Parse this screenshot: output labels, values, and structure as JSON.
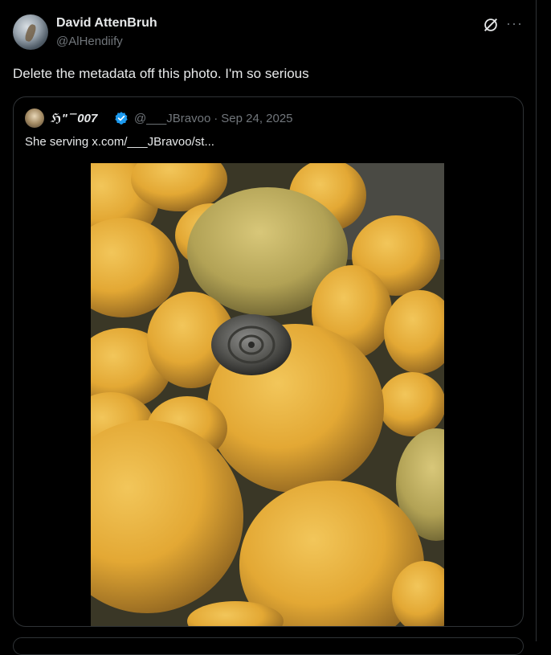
{
  "post": {
    "author": {
      "display_name": "David AttenBruh",
      "handle": "@AlHendiify"
    },
    "text": "Delete the metadata off this photo. I'm so serious",
    "icons": {
      "grok": "grok-icon",
      "more": "more-horizontal-icon"
    }
  },
  "quoted_post": {
    "display_name": "ℌ\" ̄ ̄ 007",
    "handle": "@___JBravoo",
    "separator": "·",
    "date": "Sep 24, 2025",
    "text": "She serving  x.com/___JBravoo/st...",
    "verified_icon": "verified-badge-icon",
    "image": "photo of oranges with a snail on top"
  },
  "colors": {
    "background": "#000000",
    "text": "#e7e9ea",
    "muted": "#71767b",
    "border": "#2f3336",
    "verified": "#1d9bf0"
  }
}
